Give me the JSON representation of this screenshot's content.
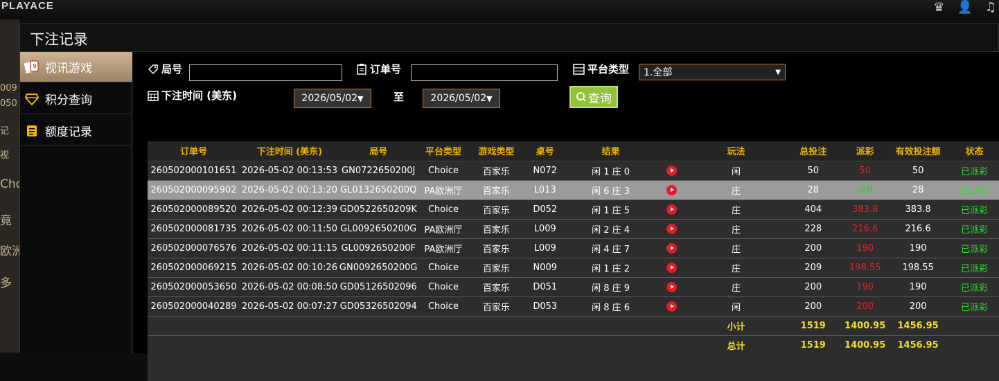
{
  "app": {
    "brand": "PLAYACE",
    "top_icons": [
      "vip-icon",
      "user-icon",
      "music-icon"
    ]
  },
  "modal": {
    "title": "下注记录"
  },
  "sidebar": {
    "items": [
      {
        "label": "视讯游戏",
        "icon": "cards-icon",
        "active": true
      },
      {
        "label": "积分查询",
        "icon": "diamond-icon",
        "active": false
      },
      {
        "label": "额度记录",
        "icon": "document-icon",
        "active": false
      }
    ]
  },
  "filters": {
    "round_label": "局号",
    "round_value": "",
    "order_label": "订单号",
    "order_value": "",
    "platform_label": "平台类型",
    "platform_value": "1.全部",
    "time_label": "下注时间 (美东)",
    "date_from": "2026/05/02",
    "to_label": "至",
    "date_to": "2026/05/02",
    "query_button": "查询"
  },
  "table": {
    "headers": [
      "订单号",
      "下注时间 (美东)",
      "局号",
      "平台类型",
      "游戏类型",
      "桌号",
      "结果",
      "",
      "玩法",
      "总投注",
      "派彩",
      "有效投注额",
      "状态"
    ],
    "rows": [
      [
        "260502000101651",
        "2026-05-02 00:13:53",
        "GN0722650200J",
        "Choice",
        "百家乐",
        "N072",
        "闲 1 庄 0",
        "",
        "闲",
        "50",
        "50",
        "50",
        "已派彩"
      ],
      [
        "260502000095902",
        "2026-05-02 00:13:20",
        "GL0132650200Q",
        "PA欧洲厅",
        "百家乐",
        "L013",
        "闲 6 庄 3",
        "",
        "庄",
        "28",
        "-28",
        "28",
        "已派彩"
      ],
      [
        "260502000089520",
        "2026-05-02 00:12:39",
        "GD0522650209K",
        "Choice",
        "百家乐",
        "D052",
        "闲 1 庄 5",
        "",
        "庄",
        "404",
        "383.8",
        "383.8",
        "已派彩"
      ],
      [
        "260502000081735",
        "2026-05-02 00:11:50",
        "GL0092650200G",
        "PA欧洲厅",
        "百家乐",
        "L009",
        "闲 2 庄 4",
        "",
        "庄",
        "228",
        "216.6",
        "216.6",
        "已派彩"
      ],
      [
        "260502000076576",
        "2026-05-02 00:11:15",
        "GL0092650200F",
        "PA欧洲厅",
        "百家乐",
        "L009",
        "闲 4 庄 7",
        "",
        "庄",
        "200",
        "190",
        "190",
        "已派彩"
      ],
      [
        "260502000069215",
        "2026-05-02 00:10:26",
        "GN0092650200G",
        "Choice",
        "百家乐",
        "N009",
        "闲 1 庄 2",
        "",
        "庄",
        "209",
        "198.55",
        "198.55",
        "已派彩"
      ],
      [
        "260502000053650",
        "2026-05-02 00:08:50",
        "GD05126502096",
        "Choice",
        "百家乐",
        "D051",
        "闲 8 庄 9",
        "",
        "庄",
        "200",
        "190",
        "190",
        "已派彩"
      ],
      [
        "260502000040289",
        "2026-05-02 00:07:27",
        "GD05326502094",
        "Choice",
        "百家乐",
        "D053",
        "闲 8 庄 6",
        "",
        "闲",
        "200",
        "200",
        "200",
        "已派彩"
      ]
    ],
    "subtotal": {
      "label": "小计",
      "total_bet": "1519",
      "payout": "1400.95",
      "valid_bet": "1456.95"
    },
    "total": {
      "label": "总计",
      "total_bet": "1519",
      "payout": "1400.95",
      "valid_bet": "1456.95"
    }
  },
  "colors": {
    "accent": "#f0b400",
    "payout_red": "#e4202a",
    "payout_green": "#1fd11f",
    "status_green": "#2be02b",
    "button_green": "#8ec33b"
  },
  "background_fragments": [
    "009",
    "050",
    "记",
    "视",
    "Cho",
    "竟",
    "欧洲",
    "多"
  ]
}
